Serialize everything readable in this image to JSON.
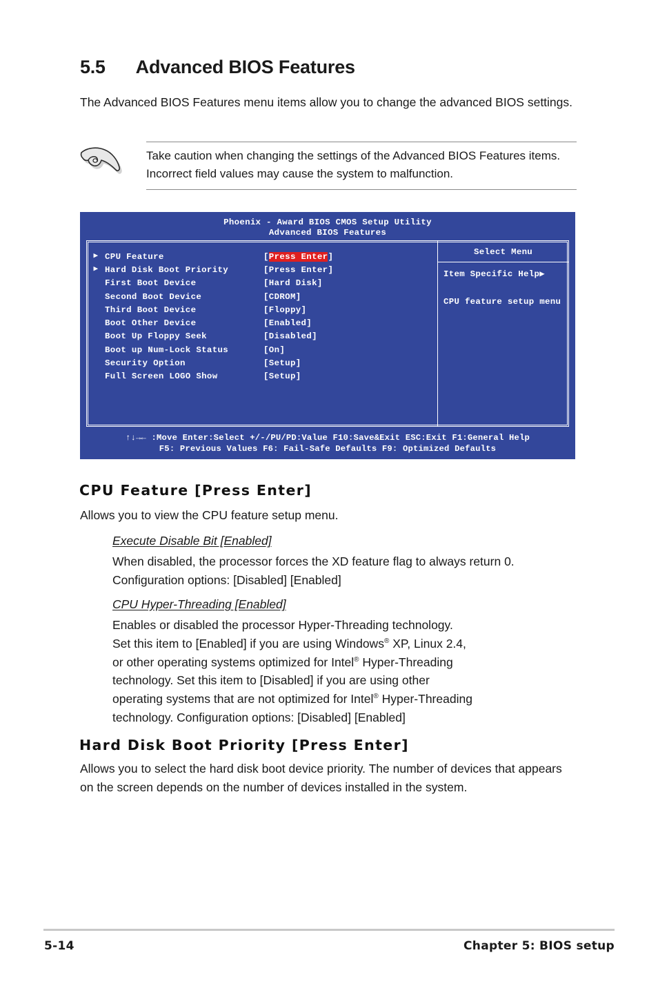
{
  "section": {
    "number": "5.5",
    "title": "Advanced BIOS Features",
    "intro": "The Advanced BIOS Features menu items allow you to change the advanced BIOS settings."
  },
  "note": {
    "icon": "pointing-hand-icon",
    "text": "Take caution when changing the settings of the Advanced BIOS Features items. Incorrect field values may cause the system to malfunction."
  },
  "bios": {
    "colors": {
      "background": "#33479b",
      "highlight": "#e01f1f",
      "text": "#ffffff"
    },
    "title_line1": "Phoenix - Award BIOS CMOS Setup Utility",
    "title_line2": "Advanced BIOS Features",
    "menu_items": [
      {
        "arrow": "▶",
        "label": "CPU Feature",
        "value": "Press Enter",
        "highlighted": true
      },
      {
        "arrow": "▶",
        "label": "Hard Disk Boot Priority",
        "value": "Press Enter",
        "highlighted": false
      },
      {
        "arrow": "",
        "label": "First Boot Device",
        "value": "Hard Disk",
        "highlighted": false
      },
      {
        "arrow": "",
        "label": "Second Boot Device",
        "value": "CDROM",
        "highlighted": false
      },
      {
        "arrow": "",
        "label": "Third Boot Device",
        "value": "Floppy",
        "highlighted": false
      },
      {
        "arrow": "",
        "label": "Boot Other Device",
        "value": "Enabled",
        "highlighted": false
      },
      {
        "arrow": "",
        "label": "Boot Up Floppy Seek",
        "value": "Disabled",
        "highlighted": false
      },
      {
        "arrow": "",
        "label": "Boot up Num-Lock Status",
        "value": "On",
        "highlighted": false
      },
      {
        "arrow": "",
        "label": "Security Option",
        "value": "Setup",
        "highlighted": false
      },
      {
        "arrow": "",
        "label": "Full Screen LOGO Show",
        "value": "Setup",
        "highlighted": false
      }
    ],
    "help_panel": {
      "header": "Select Menu",
      "line1": "Item Specific Help▶",
      "line2": "CPU feature setup menu"
    },
    "keys_line1": "↑↓→← :Move  Enter:Select  +/-/PU/PD:Value  F10:Save&Exit  ESC:Exit  F1:General Help",
    "keys_line2": "F5: Previous Values         F6: Fail-Safe Defaults        F9: Optimized Defaults"
  },
  "topics": [
    {
      "heading": "CPU Feature [Press Enter]",
      "body": "Allows you to view the CPU feature setup menu.",
      "subitems": [
        {
          "heading": "Execute Disable Bit [Enabled]",
          "body": "When disabled, the processor forces the XD feature flag to always return 0. Configuration options: [Disabled] [Enabled]"
        },
        {
          "heading": "CPU Hyper-Threading [Enabled]",
          "body_line1": "Enables or disabled the processor Hyper-Threading technology.",
          "body_line2a": "Set this item to [Enabled] if you are using Windows",
          "body_line2b": " XP, Linux 2.4,",
          "body_line3a": "or other operating systems optimized for Intel",
          "body_line3b": " Hyper-Threading",
          "body_line4": "technology. Set this item to [Disabled] if you are using other",
          "body_line5a": "operating systems that are not optimized for Intel",
          "body_line5b": " Hyper-Threading",
          "body_line6": "technology. Configuration options: [Disabled] [Enabled]"
        }
      ]
    },
    {
      "heading": "Hard Disk Boot Priority [Press Enter]",
      "body": "Allows you to select the hard disk boot device priority. The number of devices that appears on the screen depends on the number of devices installed in the system."
    }
  ],
  "footer": {
    "page_number": "5-14",
    "chapter": "Chapter 5: BIOS setup"
  }
}
